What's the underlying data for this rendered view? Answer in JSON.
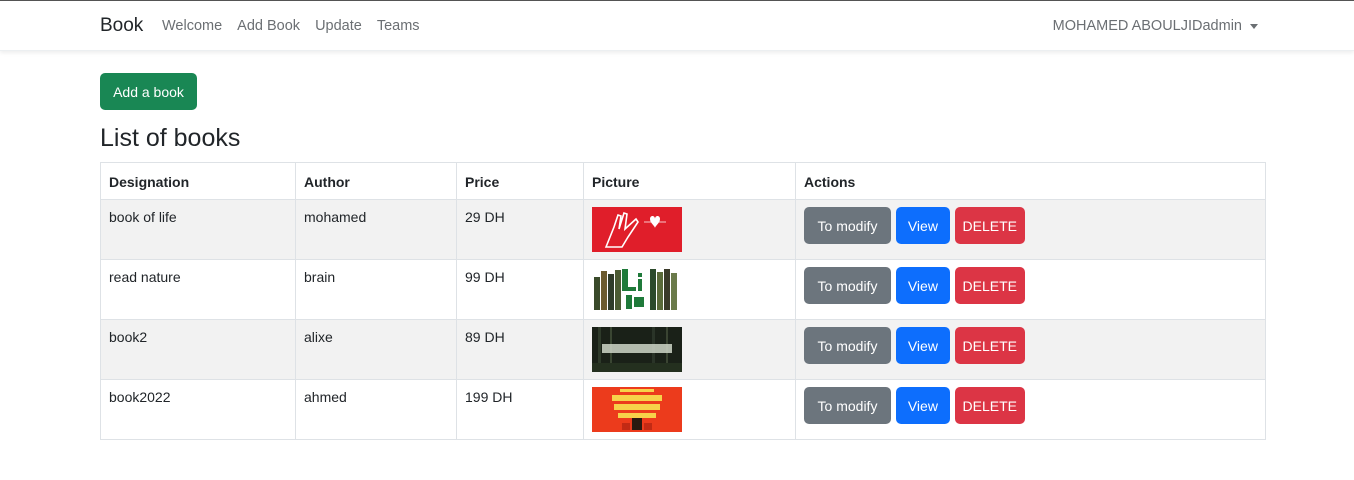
{
  "nav": {
    "brand": "Book",
    "links": [
      "Welcome",
      "Add Book",
      "Update",
      "Teams"
    ],
    "user": "MOHAMED ABOULJIDadmin"
  },
  "add_button": "Add a book",
  "title": "List of books",
  "table": {
    "headers": [
      "Designation",
      "Author",
      "Price",
      "Picture",
      "Actions"
    ],
    "rows": [
      {
        "designation": "book of life",
        "author": "mohamed",
        "price": "29 DH"
      },
      {
        "designation": "read nature",
        "author": "brain",
        "price": "99 DH"
      },
      {
        "designation": "book2",
        "author": "alixe",
        "price": "89 DH"
      },
      {
        "designation": "book2022",
        "author": "ahmed",
        "price": "199 DH"
      }
    ]
  },
  "actions": {
    "modify": "To modify",
    "view": "View",
    "delete": "DELETE"
  },
  "colors": {
    "success": "#198754",
    "secondary": "#6c757d",
    "primary": "#0d6efd",
    "danger": "#dc3545"
  }
}
